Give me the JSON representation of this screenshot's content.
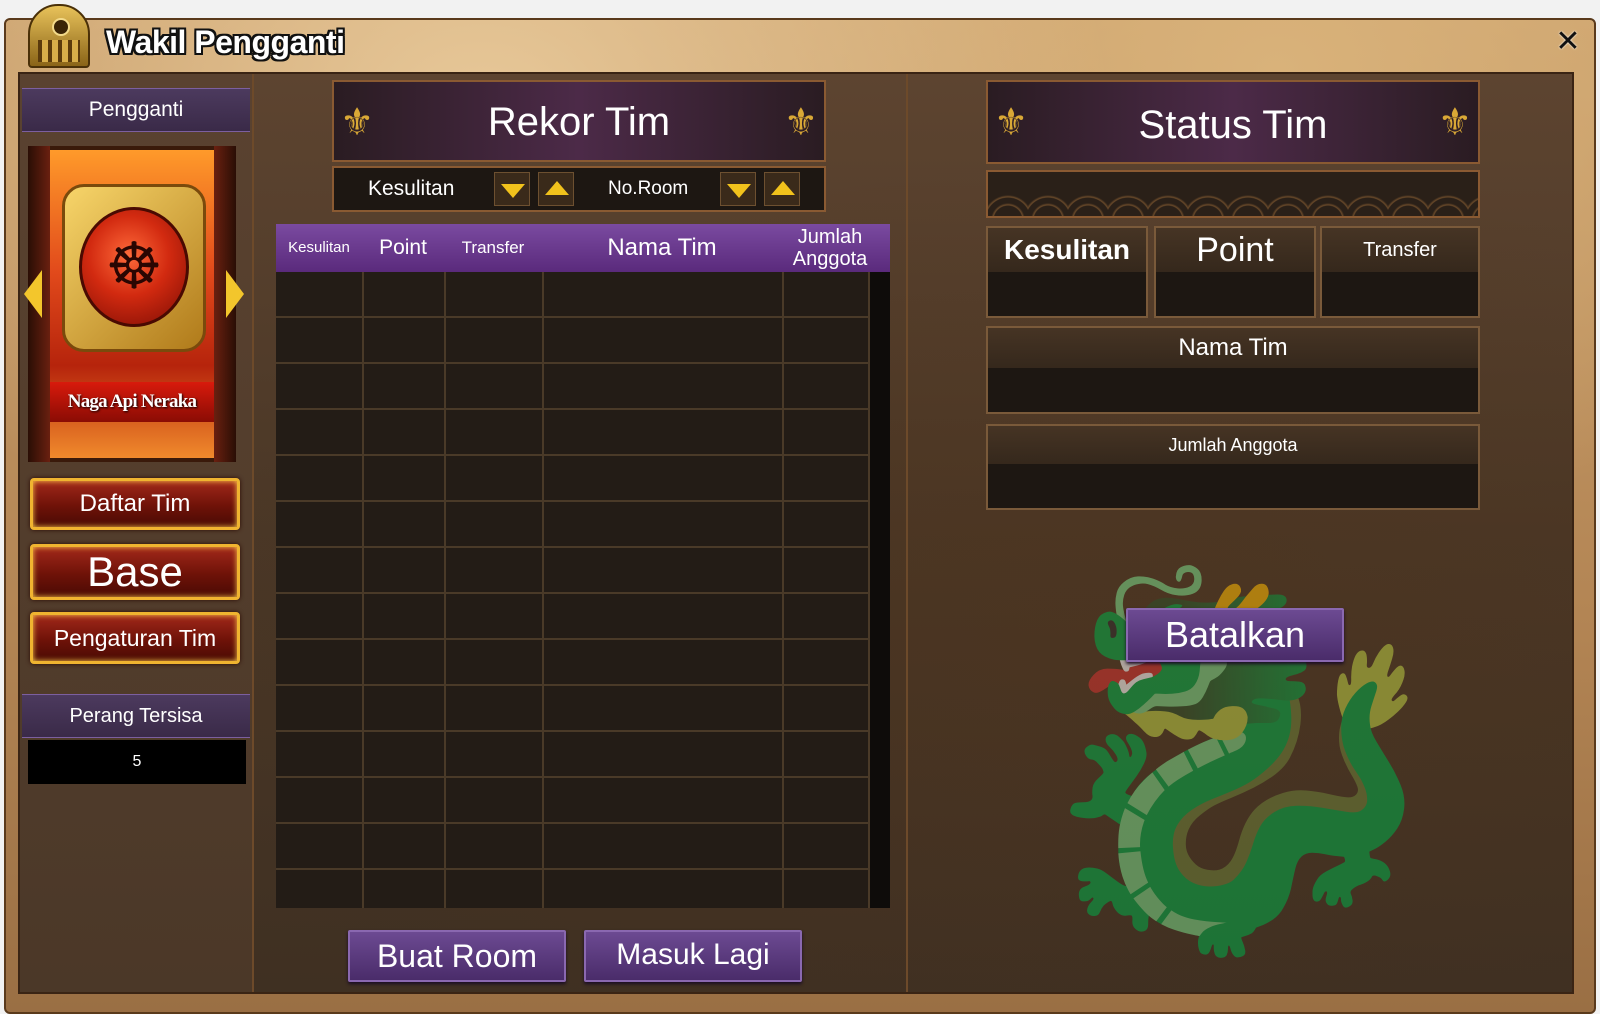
{
  "window": {
    "title": "Wakil Pengganti",
    "close_symbol": "✕"
  },
  "sidebar": {
    "header": "Pengganti",
    "hero_name": "Naga Api Neraka",
    "buttons": {
      "team_list": "Daftar Tim",
      "base": "Base",
      "team_settings": "Pengaturan Tim"
    },
    "war_remaining_label": "Perang Tersisa",
    "war_remaining_value": "5"
  },
  "middle": {
    "title": "Rekor Tim",
    "sort": {
      "difficulty_label": "Kesulitan",
      "room_label": "No.Room"
    },
    "table": {
      "columns": [
        "Kesulitan",
        "Point",
        "Transfer",
        "Nama Tim",
        "Jumlah Anggota"
      ]
    },
    "buttons": {
      "create_room": "Buat Room",
      "rejoin": "Masuk Lagi"
    }
  },
  "right": {
    "title": "Status Tim",
    "fields": {
      "difficulty": "Kesulitan",
      "point": "Point",
      "transfer": "Transfer",
      "team_name": "Nama Tim",
      "member_count": "Jumlah Anggota"
    },
    "cancel_button": "Batalkan"
  },
  "icons": {
    "title_emblem": "gate-emblem-icon",
    "close": "close-icon",
    "hero": "dragon-icon",
    "ornament": "scroll-ornament-icon",
    "sort_down": "triangle-down-icon",
    "sort_up": "triangle-up-icon"
  },
  "colors": {
    "purple_header": "#7a4aa0",
    "gold_accent": "#f1c21c",
    "red_button": "#a2281a"
  }
}
